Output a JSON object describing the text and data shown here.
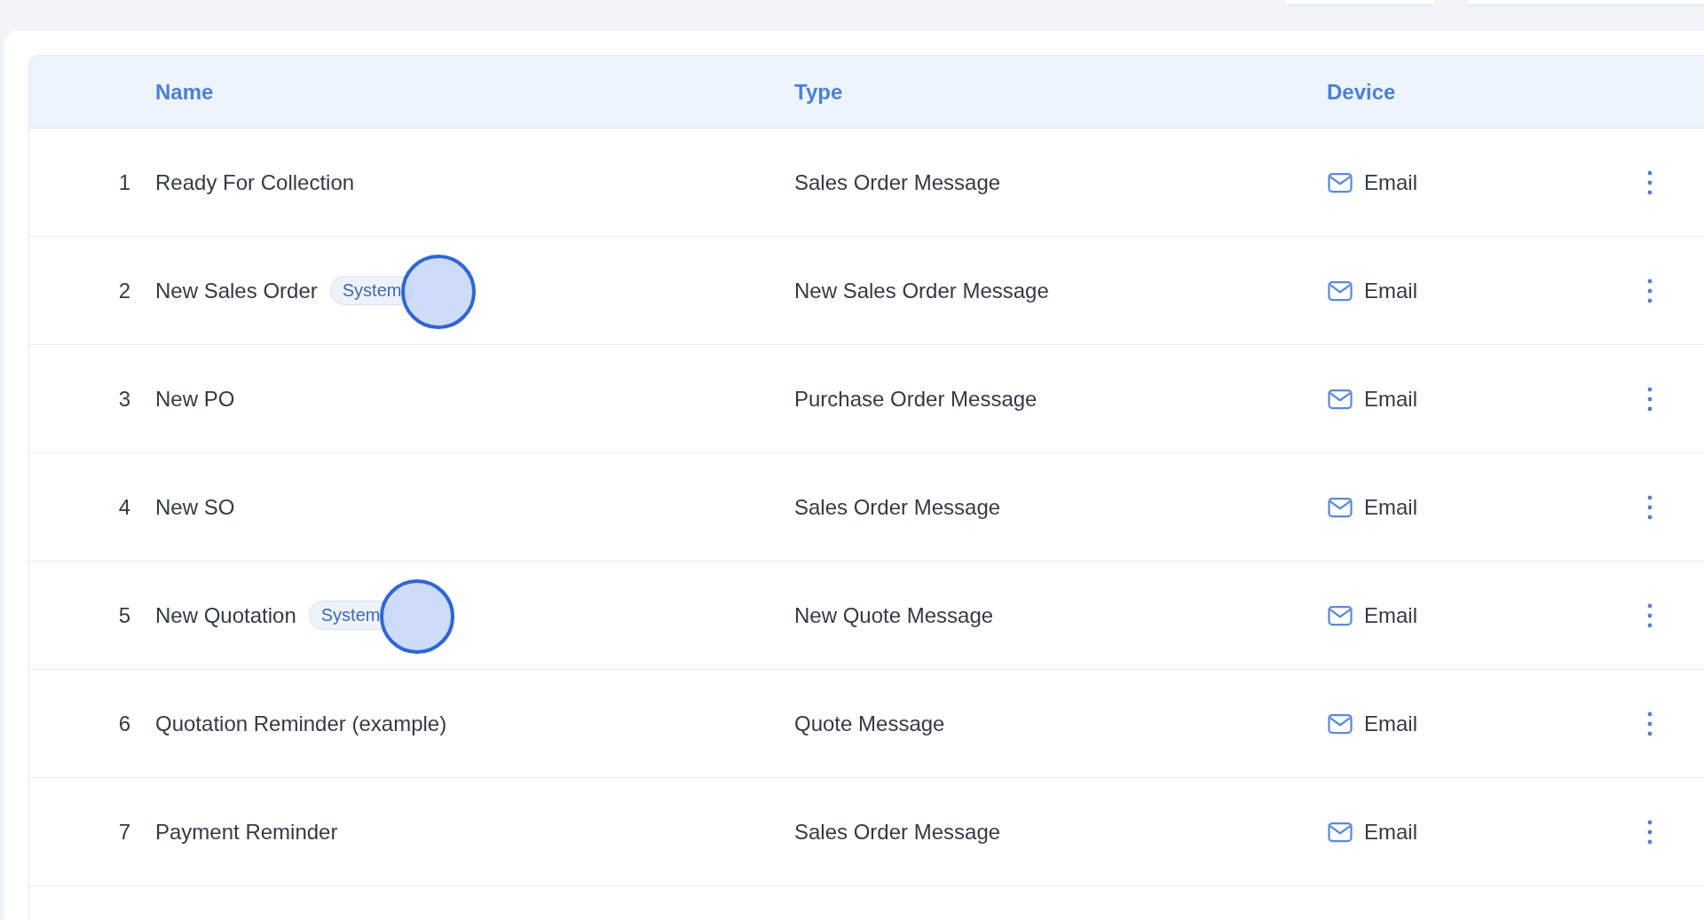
{
  "table": {
    "columns": [
      "Name",
      "Type",
      "Device"
    ],
    "rows": [
      {
        "number": "1",
        "name": "Ready For Collection",
        "type": "Sales Order Message",
        "device": "Email"
      },
      {
        "number": "2",
        "name": "New Sales Order",
        "badge": {
          "label": "System",
          "clicked": true
        },
        "type": "New Sales Order Message",
        "device": "Email"
      },
      {
        "number": "3",
        "name": "New PO",
        "type": "Purchase Order Message",
        "device": "Email"
      },
      {
        "number": "4",
        "name": "New SO",
        "type": "Sales Order Message",
        "device": "Email"
      },
      {
        "number": "5",
        "name": "New Quotation",
        "badge": {
          "label": "System",
          "clicked": true
        },
        "type": "New Quote Message",
        "device": "Email"
      },
      {
        "number": "6",
        "name": "Quotation Reminder (example)",
        "type": "Quote Message",
        "device": "Email"
      },
      {
        "number": "7",
        "name": "Payment Reminder",
        "type": "Sales Order Message",
        "device": "Email"
      }
    ]
  }
}
